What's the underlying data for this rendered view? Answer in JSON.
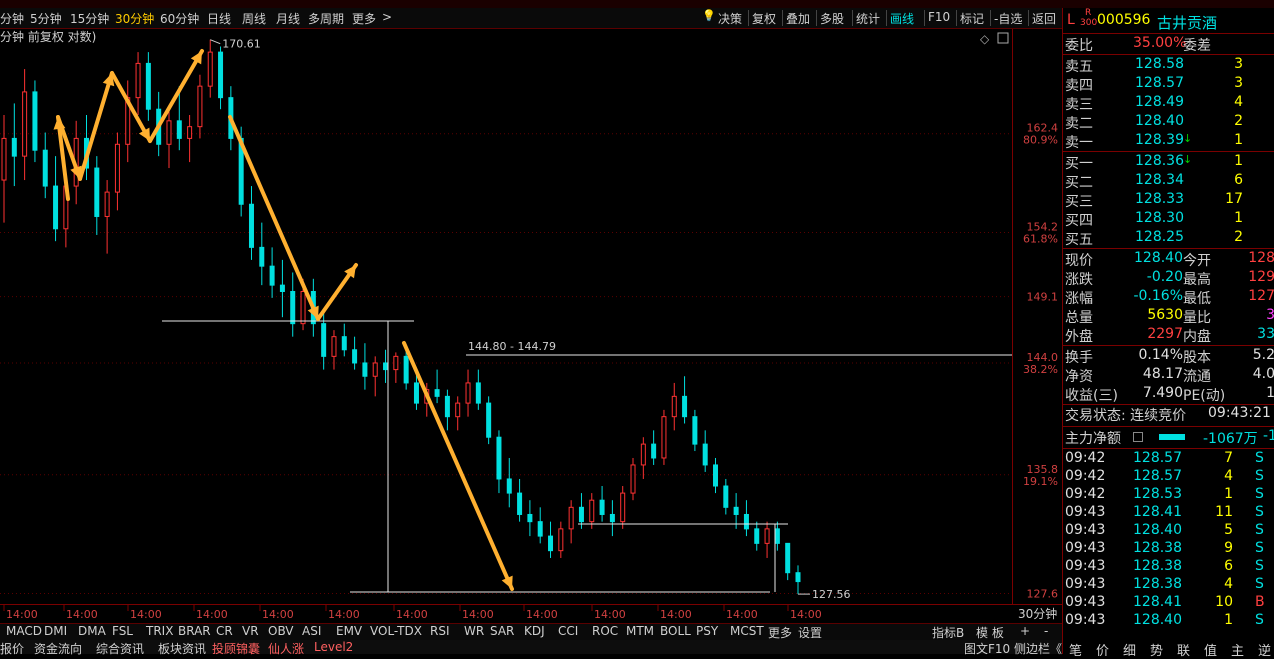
{
  "period_bar": {
    "tabs": [
      "分钟",
      "5分钟",
      "15分钟",
      "30分钟",
      "60分钟",
      "日线",
      "周线",
      "月线",
      "多周期",
      "更多"
    ],
    "active_tab": "30分钟",
    "more_arrow": ">"
  },
  "toolbar": {
    "buttons": [
      "决策",
      "复权",
      "叠加",
      "多股",
      "统计",
      "画线",
      "F10",
      "标记",
      "-自选",
      "返回"
    ],
    "active": "画线"
  },
  "chart": {
    "header": "分钟 前复权 对数)",
    "price_labels": [
      {
        "price": "162.4",
        "pct": "80.9%"
      },
      {
        "price": "154.2",
        "pct": "61.8%"
      },
      {
        "price": "149.1",
        "pct": ""
      },
      {
        "price": "144.0",
        "pct": "38.2%"
      },
      {
        "price": "135.8",
        "pct": "19.1%"
      },
      {
        "price": "127.6",
        "pct": ""
      }
    ],
    "annotations": {
      "high": "170.61",
      "mid": "144.80 - 144.79",
      "low": "127.56"
    },
    "time_labels": [
      "14:00",
      "14:00",
      "14:00",
      "14:00",
      "14:00",
      "14:00",
      "14:00",
      "14:00",
      "14:00",
      "14:00",
      "14:00",
      "14:00",
      "14:00"
    ],
    "period_label": "30分钟",
    "candles": [
      {
        "o": 158.5,
        "h": 164.0,
        "l": 155.0,
        "c": 162.0
      },
      {
        "o": 162.0,
        "h": 165.0,
        "l": 158.0,
        "c": 160.5
      },
      {
        "o": 160.5,
        "h": 168.0,
        "l": 158.5,
        "c": 166.0
      },
      {
        "o": 166.0,
        "h": 167.0,
        "l": 160.0,
        "c": 161.0
      },
      {
        "o": 161.0,
        "h": 162.5,
        "l": 157.0,
        "c": 158.0
      },
      {
        "o": 158.0,
        "h": 160.5,
        "l": 153.5,
        "c": 154.5
      },
      {
        "o": 154.5,
        "h": 159.0,
        "l": 153.0,
        "c": 158.0
      },
      {
        "o": 158.0,
        "h": 163.5,
        "l": 156.5,
        "c": 162.0
      },
      {
        "o": 162.0,
        "h": 164.0,
        "l": 158.5,
        "c": 159.5
      },
      {
        "o": 159.5,
        "h": 160.5,
        "l": 154.0,
        "c": 155.5
      },
      {
        "o": 155.5,
        "h": 158.5,
        "l": 152.5,
        "c": 157.5
      },
      {
        "o": 157.5,
        "h": 162.5,
        "l": 156.0,
        "c": 161.5
      },
      {
        "o": 161.5,
        "h": 167.0,
        "l": 160.0,
        "c": 165.5
      },
      {
        "o": 165.5,
        "h": 169.5,
        "l": 164.0,
        "c": 168.5
      },
      {
        "o": 168.5,
        "h": 169.5,
        "l": 163.5,
        "c": 164.5
      },
      {
        "o": 164.5,
        "h": 166.0,
        "l": 160.5,
        "c": 161.5
      },
      {
        "o": 161.5,
        "h": 164.5,
        "l": 159.5,
        "c": 163.5
      },
      {
        "o": 163.5,
        "h": 166.5,
        "l": 161.0,
        "c": 162.0
      },
      {
        "o": 162.0,
        "h": 164.0,
        "l": 160.0,
        "c": 163.0
      },
      {
        "o": 163.0,
        "h": 167.5,
        "l": 162.0,
        "c": 166.5
      },
      {
        "o": 166.5,
        "h": 170.61,
        "l": 165.5,
        "c": 169.5
      },
      {
        "o": 169.5,
        "h": 170.0,
        "l": 164.5,
        "c": 165.5
      },
      {
        "o": 165.5,
        "h": 166.5,
        "l": 161.0,
        "c": 162.0
      },
      {
        "o": 162.0,
        "h": 163.0,
        "l": 155.5,
        "c": 156.5
      },
      {
        "o": 156.5,
        "h": 158.0,
        "l": 152.0,
        "c": 153.0
      },
      {
        "o": 153.0,
        "h": 155.0,
        "l": 150.0,
        "c": 151.5
      },
      {
        "o": 151.5,
        "h": 153.0,
        "l": 149.0,
        "c": 150.0
      },
      {
        "o": 150.0,
        "h": 152.0,
        "l": 147.5,
        "c": 149.5
      },
      {
        "o": 149.5,
        "h": 151.0,
        "l": 146.0,
        "c": 147.0
      },
      {
        "o": 147.0,
        "h": 150.5,
        "l": 146.5,
        "c": 149.5
      },
      {
        "o": 149.5,
        "h": 150.5,
        "l": 146.0,
        "c": 147.0
      },
      {
        "o": 147.0,
        "h": 148.0,
        "l": 143.5,
        "c": 144.5
      },
      {
        "o": 144.5,
        "h": 146.5,
        "l": 143.5,
        "c": 146.0
      },
      {
        "o": 146.0,
        "h": 147.0,
        "l": 144.5,
        "c": 145.0
      },
      {
        "o": 145.0,
        "h": 146.0,
        "l": 143.5,
        "c": 144.0
      },
      {
        "o": 144.0,
        "h": 145.5,
        "l": 142.0,
        "c": 143.0
      },
      {
        "o": 143.0,
        "h": 144.5,
        "l": 141.5,
        "c": 144.0
      },
      {
        "o": 144.0,
        "h": 145.0,
        "l": 142.5,
        "c": 143.5
      },
      {
        "o": 143.5,
        "h": 144.8,
        "l": 142.5,
        "c": 144.5
      },
      {
        "o": 144.5,
        "h": 145.0,
        "l": 142.0,
        "c": 142.5
      },
      {
        "o": 142.5,
        "h": 143.5,
        "l": 140.5,
        "c": 141.0
      },
      {
        "o": 141.0,
        "h": 142.5,
        "l": 140.0,
        "c": 142.0
      },
      {
        "o": 142.0,
        "h": 143.5,
        "l": 141.0,
        "c": 141.5
      },
      {
        "o": 141.5,
        "h": 142.0,
        "l": 139.0,
        "c": 140.0
      },
      {
        "o": 140.0,
        "h": 141.5,
        "l": 139.0,
        "c": 141.0
      },
      {
        "o": 141.0,
        "h": 143.5,
        "l": 140.0,
        "c": 142.5
      },
      {
        "o": 142.5,
        "h": 143.5,
        "l": 140.5,
        "c": 141.0
      },
      {
        "o": 141.0,
        "h": 141.5,
        "l": 138.0,
        "c": 138.5
      },
      {
        "o": 138.5,
        "h": 139.0,
        "l": 134.5,
        "c": 135.5
      },
      {
        "o": 135.5,
        "h": 137.0,
        "l": 133.5,
        "c": 134.5
      },
      {
        "o": 134.5,
        "h": 135.5,
        "l": 132.5,
        "c": 133.0
      },
      {
        "o": 133.0,
        "h": 134.0,
        "l": 131.5,
        "c": 132.5
      },
      {
        "o": 132.5,
        "h": 133.5,
        "l": 131.0,
        "c": 131.5
      },
      {
        "o": 131.5,
        "h": 132.5,
        "l": 130.0,
        "c": 130.5
      },
      {
        "o": 130.5,
        "h": 132.5,
        "l": 130.0,
        "c": 132.0
      },
      {
        "o": 132.0,
        "h": 134.0,
        "l": 131.0,
        "c": 133.5
      },
      {
        "o": 133.5,
        "h": 134.5,
        "l": 132.0,
        "c": 132.5
      },
      {
        "o": 132.5,
        "h": 134.5,
        "l": 132.0,
        "c": 134.0
      },
      {
        "o": 134.0,
        "h": 135.0,
        "l": 132.5,
        "c": 133.0
      },
      {
        "o": 133.0,
        "h": 134.0,
        "l": 131.5,
        "c": 132.5
      },
      {
        "o": 132.5,
        "h": 135.0,
        "l": 132.0,
        "c": 134.5
      },
      {
        "o": 134.5,
        "h": 137.0,
        "l": 134.0,
        "c": 136.5
      },
      {
        "o": 136.5,
        "h": 138.5,
        "l": 135.5,
        "c": 138.0
      },
      {
        "o": 138.0,
        "h": 139.0,
        "l": 136.5,
        "c": 137.0
      },
      {
        "o": 137.0,
        "h": 140.5,
        "l": 136.5,
        "c": 140.0
      },
      {
        "o": 140.0,
        "h": 142.5,
        "l": 139.0,
        "c": 141.5
      },
      {
        "o": 141.5,
        "h": 143.0,
        "l": 139.5,
        "c": 140.0
      },
      {
        "o": 140.0,
        "h": 140.5,
        "l": 137.5,
        "c": 138.0
      },
      {
        "o": 138.0,
        "h": 139.0,
        "l": 136.0,
        "c": 136.5
      },
      {
        "o": 136.5,
        "h": 137.0,
        "l": 134.5,
        "c": 135.0
      },
      {
        "o": 135.0,
        "h": 135.5,
        "l": 133.0,
        "c": 133.5
      },
      {
        "o": 133.5,
        "h": 134.5,
        "l": 132.0,
        "c": 133.0
      },
      {
        "o": 133.0,
        "h": 134.0,
        "l": 131.5,
        "c": 132.0
      },
      {
        "o": 132.0,
        "h": 132.5,
        "l": 130.5,
        "c": 131.0
      },
      {
        "o": 131.0,
        "h": 132.5,
        "l": 130.0,
        "c": 132.0
      },
      {
        "o": 132.0,
        "h": 132.5,
        "l": 130.5,
        "c": 131.0
      },
      {
        "o": 131.0,
        "h": 131.0,
        "l": 128.5,
        "c": 129.0
      },
      {
        "o": 129.0,
        "h": 129.5,
        "l": 127.56,
        "c": 128.4
      }
    ]
  },
  "indicator_bar": {
    "items": [
      "MACD",
      "DMI",
      "DMA",
      "FSL",
      "TRIX",
      "BRAR",
      "CR",
      "VR",
      "OBV",
      "ASI",
      "EMV",
      "VOL-TDX",
      "RSI",
      "WR",
      "SAR",
      "KDJ",
      "CCI",
      "ROC",
      "MTM",
      "BOLL",
      "PSY",
      "MCST",
      "更多",
      "设置"
    ],
    "right_items": [
      "指标B",
      "模 板",
      "+",
      "-"
    ]
  },
  "bottom_bar": {
    "items": [
      "报价",
      "资金流向",
      "综合资讯",
      "板块资讯",
      "投顾锦囊",
      "仙人涨",
      "Level2"
    ],
    "right_text": "图文F10 侧边栏《"
  },
  "right_panel": {
    "prefix": "L",
    "badge_top": "R",
    "badge_bottom": "300",
    "code": "000596",
    "name": "古井贡酒",
    "weibi_label": "委比",
    "weibi_value": "35.00%",
    "weicha_label": "委差",
    "sells": [
      {
        "label": "卖五",
        "price": "128.58",
        "vol": "3",
        "arrow": ""
      },
      {
        "label": "卖四",
        "price": "128.57",
        "vol": "3",
        "arrow": ""
      },
      {
        "label": "卖三",
        "price": "128.49",
        "vol": "4",
        "arrow": ""
      },
      {
        "label": "卖二",
        "price": "128.40",
        "vol": "2",
        "arrow": ""
      },
      {
        "label": "卖一",
        "price": "128.39",
        "vol": "1",
        "arrow": "↓"
      }
    ],
    "buys": [
      {
        "label": "买一",
        "price": "128.36",
        "vol": "1",
        "arrow": "↓"
      },
      {
        "label": "买二",
        "price": "128.34",
        "vol": "6",
        "arrow": ""
      },
      {
        "label": "买三",
        "price": "128.33",
        "vol": "17",
        "arrow": ""
      },
      {
        "label": "买四",
        "price": "128.30",
        "vol": "1",
        "arrow": ""
      },
      {
        "label": "买五",
        "price": "128.25",
        "vol": "2",
        "arrow": ""
      }
    ],
    "stats": [
      {
        "l1": "现价",
        "v1": "128.40",
        "l2": "今开",
        "v2": "128"
      },
      {
        "l1": "涨跌",
        "v1": "-0.20",
        "l2": "最高",
        "v2": "129"
      },
      {
        "l1": "涨幅",
        "v1": "-0.16%",
        "l2": "最低",
        "v2": "127"
      },
      {
        "l1": "总量",
        "v1": "5630",
        "l2": "量比",
        "v2": "3"
      },
      {
        "l1": "外盘",
        "v1": "2297",
        "l2": "内盘",
        "v2": "33"
      }
    ],
    "stats2": [
      {
        "l1": "换手",
        "v1": "0.14%",
        "l2": "股本",
        "v2": "5.2"
      },
      {
        "l1": "净资",
        "v1": "48.17",
        "l2": "流通",
        "v2": "4.0"
      },
      {
        "l1": "收益(三)",
        "v1": "7.490",
        "l2": "PE(动)",
        "v2": "1"
      }
    ],
    "trade_status": "交易状态: 连续竞价",
    "trade_time": "09:43:21",
    "main_flow_label": "主力净额",
    "main_flow_value": "-1067万",
    "main_flow_extra": "-1",
    "ticks": [
      {
        "t": "09:42",
        "p": "128.57",
        "v": "7",
        "s": "S"
      },
      {
        "t": "09:42",
        "p": "128.57",
        "v": "4",
        "s": "S"
      },
      {
        "t": "09:42",
        "p": "128.53",
        "v": "1",
        "s": "S"
      },
      {
        "t": "09:43",
        "p": "128.41",
        "v": "11",
        "s": "S"
      },
      {
        "t": "09:43",
        "p": "128.40",
        "v": "5",
        "s": "S"
      },
      {
        "t": "09:43",
        "p": "128.38",
        "v": "9",
        "s": "S"
      },
      {
        "t": "09:43",
        "p": "128.38",
        "v": "6",
        "s": "S"
      },
      {
        "t": "09:43",
        "p": "128.38",
        "v": "4",
        "s": "S"
      },
      {
        "t": "09:43",
        "p": "128.41",
        "v": "10",
        "s": "B"
      },
      {
        "t": "09:43",
        "p": "128.40",
        "v": "1",
        "s": "S"
      }
    ],
    "bottom_tabs": [
      "笔",
      "价",
      "细",
      "势",
      "联",
      "值",
      "主",
      "逆"
    ]
  },
  "colors": {
    "up": "#ff3232",
    "down": "#00e0e0",
    "arrow": "#ffb030",
    "frame": "#7a0000"
  }
}
